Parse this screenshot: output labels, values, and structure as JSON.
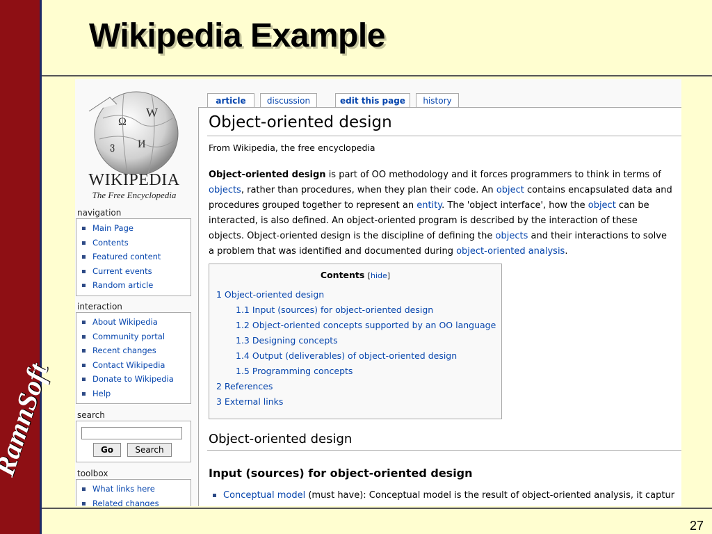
{
  "slide": {
    "title": "Wikipedia Example",
    "brand": "RamnSoft",
    "page_number": "27",
    "colors": {
      "band": "#8e0f14",
      "background": "#fffed0",
      "link": "#0645ad"
    }
  },
  "wiki": {
    "logo": {
      "wordmark": "WIKIPEDIA",
      "tagline": "The Free Encyclopedia"
    },
    "tabs": [
      "article",
      "discussion",
      "edit this page",
      "history"
    ],
    "navigation": {
      "heading": "navigation",
      "items": [
        "Main Page",
        "Contents",
        "Featured content",
        "Current events",
        "Random article"
      ]
    },
    "interaction": {
      "heading": "interaction",
      "items": [
        "About Wikipedia",
        "Community portal",
        "Recent changes",
        "Contact Wikipedia",
        "Donate to Wikipedia",
        "Help"
      ]
    },
    "search": {
      "heading": "search",
      "go_label": "Go",
      "search_label": "Search"
    },
    "toolbox": {
      "heading": "toolbox",
      "items": [
        "What links here",
        "Related changes"
      ]
    },
    "article": {
      "title": "Object-oriented design",
      "from": "From Wikipedia, the free encyclopedia",
      "intro": {
        "lead": "Object-oriented design",
        "t1": " is part of OO methodology and it forces programmers to think in terms of ",
        "l1": "objects",
        "t2": ", rather than procedures, when they plan their code. An ",
        "l2": "object",
        "t3": " contains encapsulated data and procedures grouped together to represent an ",
        "l3": "entity",
        "t4": ". The 'object interface', how the ",
        "l4": "object",
        "t5": " can be interacted, is also defined. An object-oriented program is described by the interaction of these objects. Object-oriented design is the discipline of defining the ",
        "l5": "objects",
        "t6": " and their interactions to solve a problem that was identified and documented during ",
        "l6": "object-oriented analysis",
        "t7": "."
      },
      "toc": {
        "title": "Contents",
        "hide_label": "hide",
        "entries": [
          "1 Object-oriented design",
          "1.1 Input (sources) for object-oriented design",
          "1.2 Object-oriented concepts supported by an OO language",
          "1.3 Designing concepts",
          "1.4 Output (deliverables) of object-oriented design",
          "1.5 Programming concepts",
          "2 References",
          "3 External links"
        ]
      },
      "section_heading": "Object-oriented design",
      "subsection_heading": "Input (sources) for object-oriented design",
      "bullet_link": "Conceptual model",
      "bullet_text": " (must have): Conceptual model is the result of object-oriented analysis, it captur"
    }
  }
}
